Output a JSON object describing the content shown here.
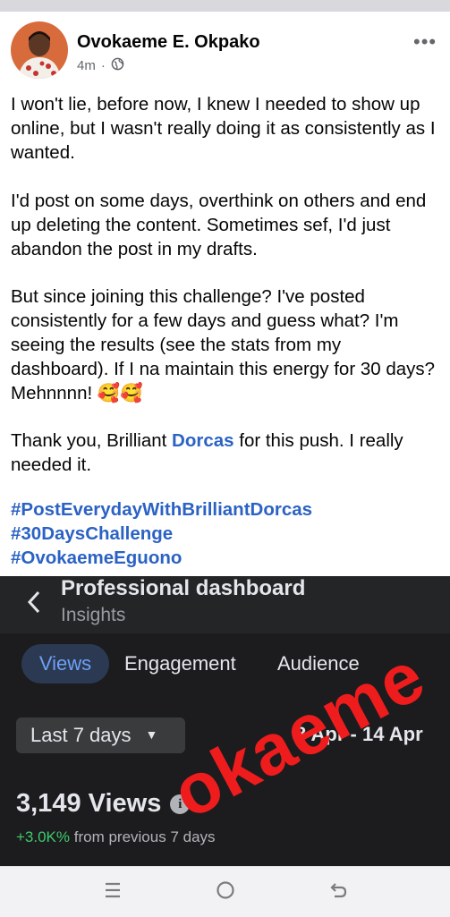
{
  "post": {
    "author": "Ovokaeme E. Okpako",
    "time": "4m",
    "separator": "·",
    "more_label": "•••",
    "paragraph1": "I won't lie, before now, I knew I needed to show up online, but I wasn't really doing it as consistently as I wanted.",
    "paragraph2": "I'd post on some days, overthink on others and end up deleting the content. Sometimes sef, I'd just abandon the post in my drafts.",
    "paragraph3": "But since joining this challenge? I've posted consistently for a few days and guess what? I'm seeing the results (see the stats from my dashboard). If I na maintain this energy for 30 days? Mehnnnn! 🥰🥰",
    "paragraph4_before": "Thank you, Brilliant ",
    "paragraph4_mention": "Dorcas",
    "paragraph4_after": " for this push. I really needed it.",
    "hashtags": [
      "#PostEverydayWithBrilliantDorcas",
      "#30DaysChallenge",
      "#OvokaemeEguono"
    ]
  },
  "dashboard": {
    "title": "Professional dashboard",
    "subtitle": "Insights",
    "tabs": [
      "Views",
      "Engagement",
      "Audience"
    ],
    "range_label": "Last 7 days",
    "date_range": "8 Apr - 14 Apr",
    "views_count": "3,149 Views",
    "info_glyph": "i",
    "change_value": "+3.0K%",
    "change_text": " from previous 7 days",
    "watermark": "okaeme"
  },
  "icons": {
    "globe": "globe-icon",
    "back": "chevron-left-icon",
    "dropdown": "caret-down-icon",
    "info": "info-icon",
    "nav_recent": "recent-apps-icon",
    "nav_home": "home-icon",
    "nav_back": "back-icon"
  },
  "colors": {
    "link": "#2b62c4",
    "dashboard_bg": "#1c1c1e",
    "positive": "#3ec96a",
    "watermark": "#ee1c1c"
  }
}
